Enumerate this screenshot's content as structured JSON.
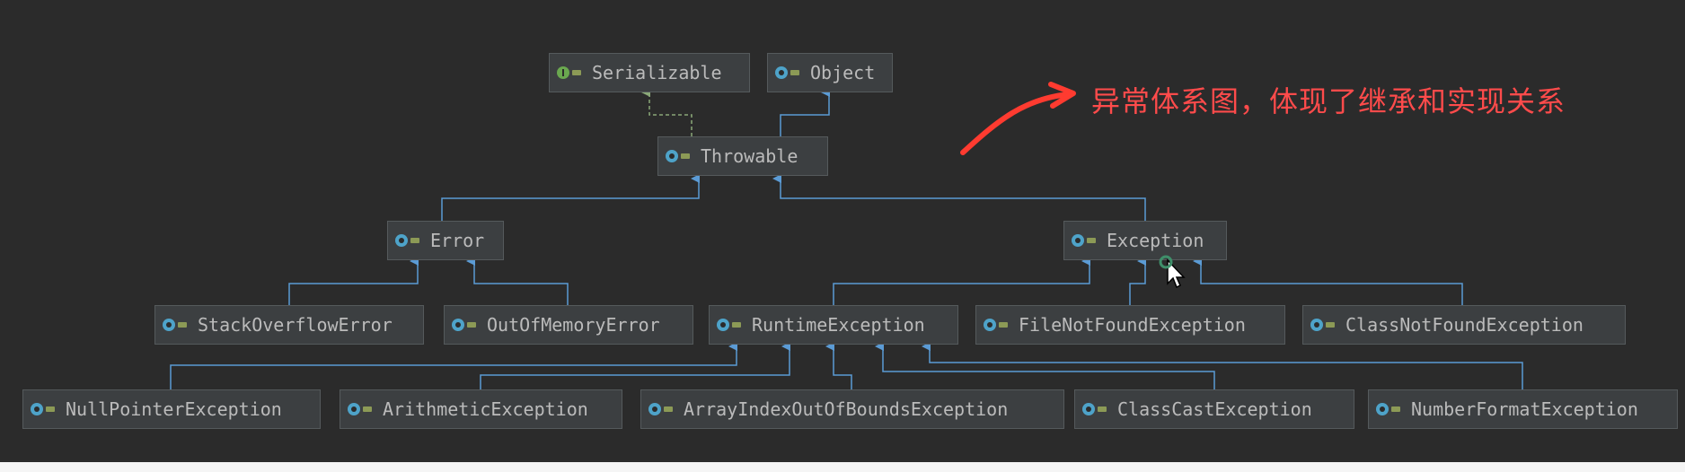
{
  "annotation": "异常体系图，体现了继承和实现关系",
  "colors": {
    "background": "#2b2b2b",
    "node_fill": "#3c3f41",
    "node_text": "#bbbbbb",
    "inheritance_line": "#5b9bd5",
    "realization_line": "#8aa878",
    "annotation": "#ff4b4b"
  },
  "icons": {
    "class": "class-icon",
    "interface": "interface-icon"
  },
  "nodes": {
    "serializable": "Serializable",
    "object": "Object",
    "throwable": "Throwable",
    "error": "Error",
    "exception": "Exception",
    "stackoverflowerror": "StackOverflowError",
    "outofmemoryerror": "OutOfMemoryError",
    "runtimeexception": "RuntimeException",
    "filenotfoundexception": "FileNotFoundException",
    "classnotfoundexception": "ClassNotFoundException",
    "nullpointerexception": "NullPointerException",
    "arithmeticexception": "ArithmeticException",
    "arrayindexoutofboundsexception": "ArrayIndexOutOfBoundsException",
    "classcastexception": "ClassCastException",
    "numberformatexception": "NumberFormatException"
  },
  "relations": [
    {
      "from": "Throwable",
      "to": "Serializable",
      "kind": "implements"
    },
    {
      "from": "Throwable",
      "to": "Object",
      "kind": "extends"
    },
    {
      "from": "Error",
      "to": "Throwable",
      "kind": "extends"
    },
    {
      "from": "Exception",
      "to": "Throwable",
      "kind": "extends"
    },
    {
      "from": "StackOverflowError",
      "to": "Error",
      "kind": "extends"
    },
    {
      "from": "OutOfMemoryError",
      "to": "Error",
      "kind": "extends"
    },
    {
      "from": "RuntimeException",
      "to": "Exception",
      "kind": "extends"
    },
    {
      "from": "FileNotFoundException",
      "to": "Exception",
      "kind": "extends"
    },
    {
      "from": "ClassNotFoundException",
      "to": "Exception",
      "kind": "extends"
    },
    {
      "from": "NullPointerException",
      "to": "RuntimeException",
      "kind": "extends"
    },
    {
      "from": "ArithmeticException",
      "to": "RuntimeException",
      "kind": "extends"
    },
    {
      "from": "ArrayIndexOutOfBoundsException",
      "to": "RuntimeException",
      "kind": "extends"
    },
    {
      "from": "ClassCastException",
      "to": "RuntimeException",
      "kind": "extends"
    },
    {
      "from": "NumberFormatException",
      "to": "RuntimeException",
      "kind": "extends"
    }
  ]
}
